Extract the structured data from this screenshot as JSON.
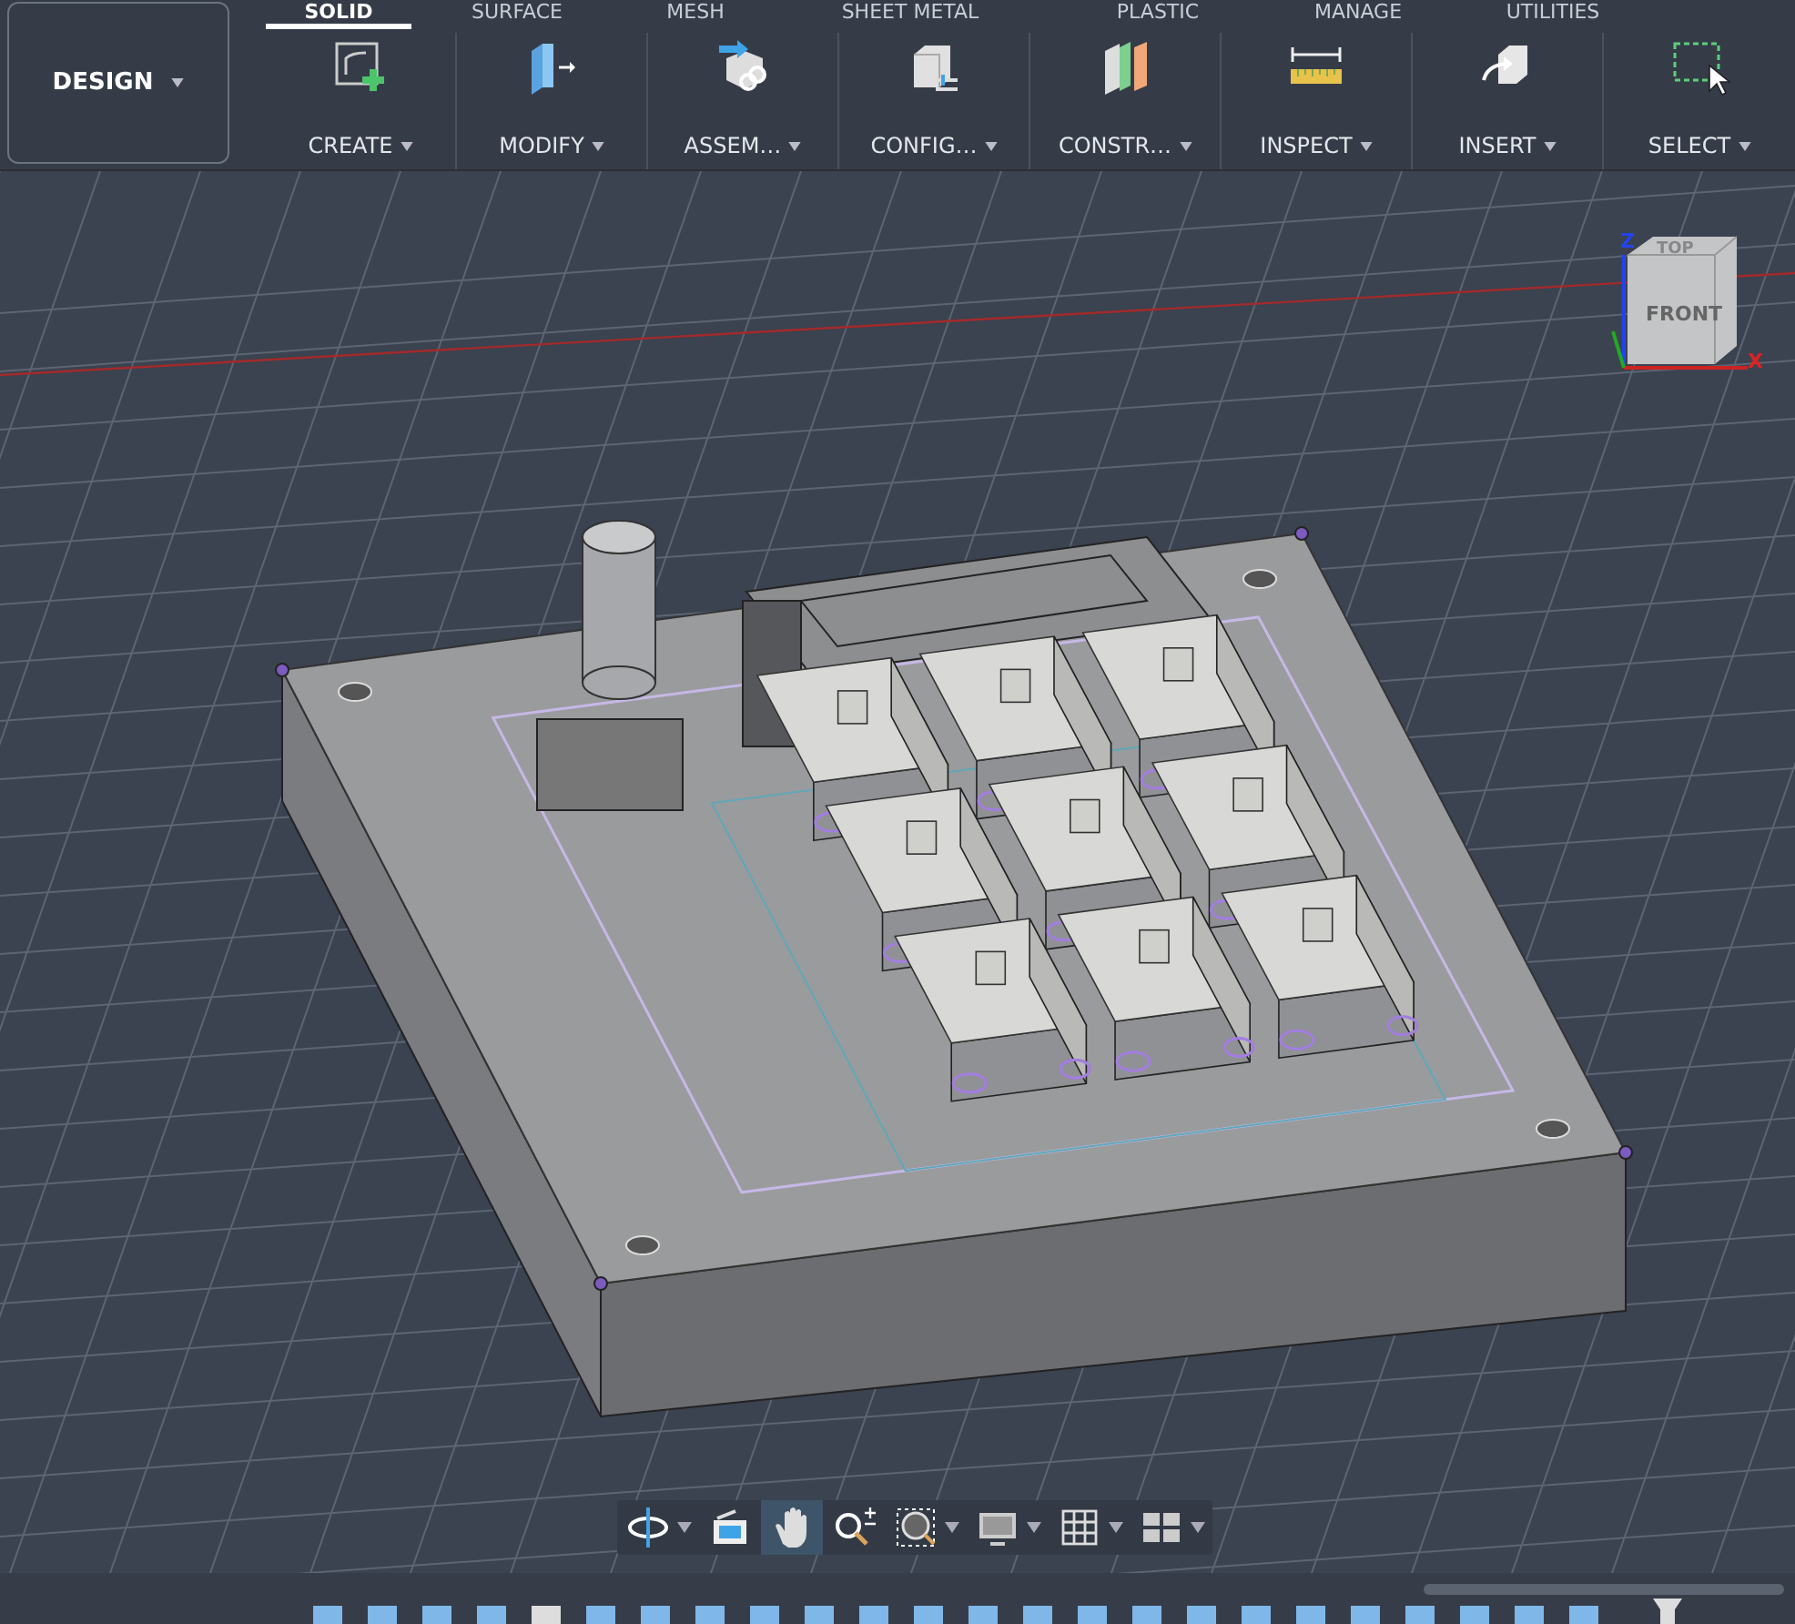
{
  "workspace_button": {
    "label": "DESIGN"
  },
  "tabs": [
    {
      "label": "SOLID",
      "selected": true
    },
    {
      "label": "SURFACE",
      "selected": false
    },
    {
      "label": "MESH",
      "selected": false
    },
    {
      "label": "SHEET METAL",
      "selected": false
    },
    {
      "label": "PLASTIC",
      "selected": false
    },
    {
      "label": "MANAGE",
      "selected": false
    },
    {
      "label": "UTILITIES",
      "selected": false
    }
  ],
  "tools": [
    {
      "label": "CREATE",
      "kind": "create"
    },
    {
      "label": "MODIFY",
      "kind": "modify"
    },
    {
      "label": "ASSEM…",
      "kind": "assemble"
    },
    {
      "label": "CONFIG…",
      "kind": "configure"
    },
    {
      "label": "CONSTR…",
      "kind": "construct"
    },
    {
      "label": "INSPECT",
      "kind": "inspect"
    },
    {
      "label": "INSERT",
      "kind": "insert"
    },
    {
      "label": "SELECT",
      "kind": "select"
    }
  ],
  "viewcube": {
    "top": "TOP",
    "front": "FRONT",
    "x_axis": "X",
    "z_axis": "Z"
  },
  "nav_tools": [
    {
      "kind": "orbit",
      "dropdown": true,
      "selected": false
    },
    {
      "kind": "look",
      "dropdown": false,
      "selected": false
    },
    {
      "kind": "pan",
      "dropdown": false,
      "selected": true
    },
    {
      "kind": "zoom",
      "dropdown": false,
      "selected": false
    },
    {
      "kind": "fit",
      "dropdown": true,
      "selected": false
    },
    {
      "kind": "display",
      "dropdown": true,
      "selected": false
    },
    {
      "kind": "grid",
      "dropdown": true,
      "selected": false
    },
    {
      "kind": "viewports",
      "dropdown": true,
      "selected": false
    }
  ]
}
